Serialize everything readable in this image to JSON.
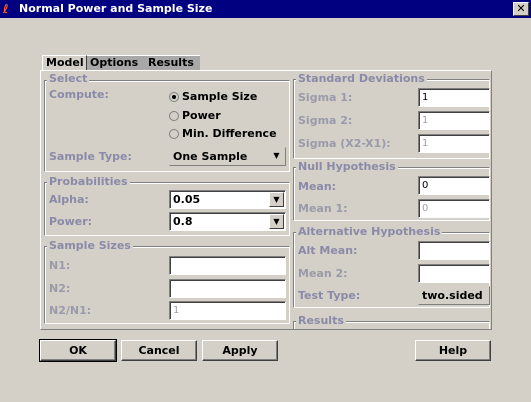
{
  "window": {
    "title": "Normal Power and Sample Size",
    "close": "✕"
  },
  "tabs": [
    "Model",
    "Options",
    "Results"
  ],
  "select": {
    "title": "Select",
    "compute_label": "Compute:",
    "options": [
      "Sample Size",
      "Power",
      "Min. Difference"
    ],
    "selected": "Sample Size",
    "sample_type_label": "Sample Type:",
    "sample_type_value": "One Sample"
  },
  "probabilities": {
    "title": "Probabilities",
    "alpha_label": "Alpha:",
    "alpha_value": "0.05",
    "power_label": "Power:",
    "power_value": "0.8"
  },
  "sample_sizes": {
    "title": "Sample Sizes",
    "n1_label": "N1:",
    "n1_value": "",
    "n2_label": "N2:",
    "n2_value": "",
    "ratio_label": "N2/N1:",
    "ratio_value": "1"
  },
  "std_devs": {
    "title": "Standard Deviations",
    "sigma1_label": "Sigma 1:",
    "sigma1_value": "1",
    "sigma2_label": "Sigma 2:",
    "sigma2_value": "1",
    "sigma_diff_label": "Sigma (X2-X1):",
    "sigma_diff_value": "1"
  },
  "null_hyp": {
    "title": "Null Hypothesis",
    "mean_label": "Mean:",
    "mean_value": "0",
    "mean1_label": "Mean 1:",
    "mean1_value": "0"
  },
  "alt_hyp": {
    "title": "Alternative Hypothesis",
    "alt_mean_label": "Alt Mean:",
    "alt_mean_value": "",
    "mean2_label": "Mean 2:",
    "mean2_value": "",
    "test_type_label": "Test Type:",
    "test_type_value": "two.sided"
  },
  "results": {
    "title": "Results"
  },
  "buttons": {
    "ok": "OK",
    "cancel": "Cancel",
    "apply": "Apply",
    "help": "Help"
  }
}
